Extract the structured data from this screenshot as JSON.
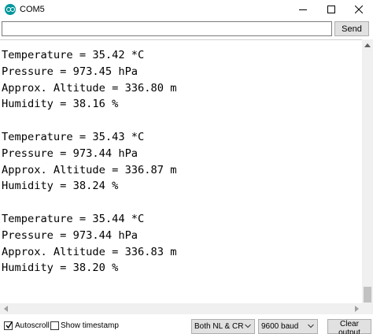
{
  "window": {
    "title": "COM5",
    "icon": "arduino-icon"
  },
  "send_bar": {
    "input_value": "",
    "send_label": "Send"
  },
  "output": {
    "lines": [
      "Temperature = 35.42 *C",
      "Pressure = 973.45 hPa",
      "Approx. Altitude = 336.80 m",
      "Humidity = 38.16 %",
      "",
      "Temperature = 35.43 *C",
      "Pressure = 973.44 hPa",
      "Approx. Altitude = 336.87 m",
      "Humidity = 38.24 %",
      "",
      "Temperature = 35.44 *C",
      "Pressure = 973.44 hPa",
      "Approx. Altitude = 336.83 m",
      "Humidity = 38.20 %"
    ]
  },
  "status_bar": {
    "autoscroll_label": "Autoscroll",
    "autoscroll_checked": true,
    "timestamp_label": "Show timestamp",
    "timestamp_checked": false,
    "line_ending": "Both NL & CR",
    "baud_rate": "9600 baud",
    "clear_label": "Clear output"
  },
  "colors": {
    "arduino_teal": "#00979c",
    "button_face": "#e1e1e1",
    "scrollbar_track": "#f0f0f0"
  }
}
